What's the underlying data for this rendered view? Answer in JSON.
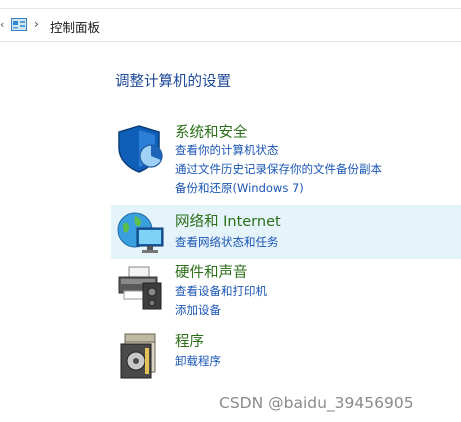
{
  "address_bar": {
    "breadcrumb": "控制面板",
    "separator": "›",
    "left_chevron": "‹",
    "icon": "control-panel-icon"
  },
  "main": {
    "heading": "调整计算机的设置",
    "categories": [
      {
        "title": "系统和安全",
        "icon": "shield-icon",
        "links": [
          "查看你的计算机状态",
          "通过文件历史记录保存你的文件备份副本",
          "备份和还原(Windows 7)"
        ]
      },
      {
        "title": "网络和 Internet",
        "icon": "network-globe-icon",
        "links": [
          "查看网络状态和任务"
        ]
      },
      {
        "title": "硬件和声音",
        "icon": "printer-speaker-icon",
        "links": [
          "查看设备和打印机",
          "添加设备"
        ]
      },
      {
        "title": "程序",
        "icon": "programs-icon",
        "links": [
          "卸载程序"
        ]
      }
    ]
  },
  "watermark": "CSDN @baidu_39456905",
  "colors": {
    "heading": "#1b4796",
    "category_title": "#2b6f18",
    "link": "#1a56b3",
    "hover_bg": "#e5f3fb"
  }
}
